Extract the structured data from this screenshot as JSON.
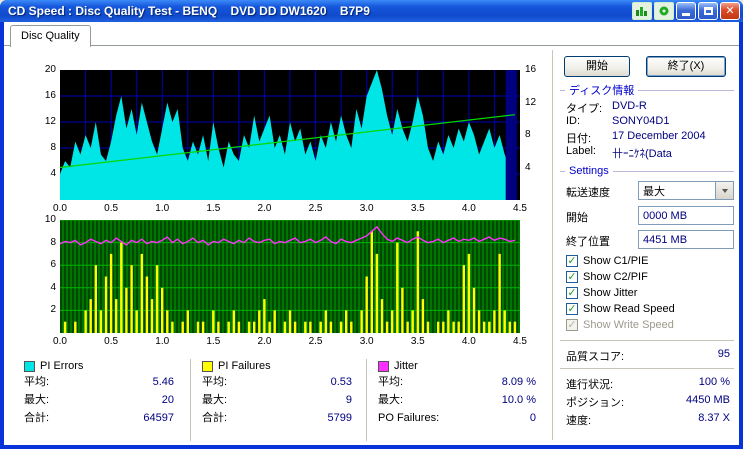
{
  "window": {
    "title": "CD Speed : Disc Quality Test - BENQ    DVD DD DW1620    B7P9"
  },
  "titlebar": {
    "icons": [
      "chart-icon",
      "disc-icon"
    ],
    "buttons": [
      "minimize",
      "maximize",
      "close"
    ]
  },
  "tab": {
    "label": "Disc Quality"
  },
  "toolbar": {
    "start_label": "開始",
    "exit_label": "終了(X)"
  },
  "disc_info": {
    "header": "ディスク情報",
    "type_label": "タイプ:",
    "type_value": "DVD-R",
    "id_label": "ID:",
    "id_value": "SONY04D1",
    "date_label": "日付:",
    "date_value": "17 December 2004",
    "label_label": "Label:",
    "label_value": "卄ｰﾆｹﾈ(Data"
  },
  "settings": {
    "header": "Settings",
    "transfer_label": "転送速度",
    "transfer_value": "最大",
    "start_label": "開始",
    "start_value": "0000 MB",
    "end_label": "終了位置",
    "end_value": "4451 MB",
    "checkboxes": [
      {
        "label": "Show C1/PIE",
        "checked": true,
        "disabled": false
      },
      {
        "label": "Show C2/PIF",
        "checked": true,
        "disabled": false
      },
      {
        "label": "Show Jitter",
        "checked": true,
        "disabled": false
      },
      {
        "label": "Show Read Speed",
        "checked": true,
        "disabled": false
      },
      {
        "label": "Show Write Speed",
        "checked": true,
        "disabled": true
      }
    ]
  },
  "status": {
    "score_label": "品質スコア:",
    "score_value": "95",
    "progress_label": "進行状況:",
    "progress_value": "100 %",
    "position_label": "ポジション:",
    "position_value": "4450 MB",
    "speed_label": "速度:",
    "speed_value": "8.37 X"
  },
  "stats": {
    "groups": [
      {
        "name": "PI Errors",
        "color": "#00E5E5",
        "rows": [
          {
            "label": "平均:",
            "value": "5.46"
          },
          {
            "label": "最大:",
            "value": "20"
          },
          {
            "label": "合計:",
            "value": "64597"
          }
        ]
      },
      {
        "name": "PI Failures",
        "color": "#FFFF00",
        "rows": [
          {
            "label": "平均:",
            "value": "0.53"
          },
          {
            "label": "最大:",
            "value": "9"
          },
          {
            "label": "合計:",
            "value": "5799"
          }
        ]
      },
      {
        "name": "Jitter",
        "color": "#FF30FF",
        "rows": [
          {
            "label": "平均:",
            "value": "8.09 %"
          },
          {
            "label": "最大:",
            "value": "10.0 %"
          },
          {
            "label": "PO Failures:",
            "value": "0"
          }
        ]
      }
    ]
  },
  "chart_data": [
    {
      "type": "area",
      "name": "pi-errors-and-read-speed",
      "x_start": 0,
      "x_step": 0.05,
      "x_end": 4.45,
      "xlim": [
        0,
        4.5
      ],
      "ylim_left": [
        0,
        20
      ],
      "yticks_left": [
        4,
        8,
        12,
        16,
        20
      ],
      "ylim_right": [
        0,
        16
      ],
      "yticks_right": [
        4,
        8,
        12,
        16
      ],
      "xticks": [
        "0.0",
        "0.5",
        "1.0",
        "1.5",
        "2.0",
        "2.5",
        "3.0",
        "3.5",
        "4.0",
        "4.5"
      ],
      "series": [
        {
          "name": "PI Errors",
          "color": "#00E5E5",
          "style": "area",
          "axis": "left",
          "values": [
            4,
            6,
            5,
            9,
            7,
            10,
            8,
            12,
            7,
            6,
            9,
            13,
            16,
            11,
            14,
            10,
            15,
            12,
            9,
            7,
            11,
            15,
            12,
            14,
            8,
            6,
            9,
            7,
            10,
            6,
            12,
            8,
            5,
            9,
            7,
            6,
            10,
            8,
            13,
            9,
            11,
            13,
            8,
            10,
            7,
            12,
            9,
            11,
            7,
            9,
            6,
            10,
            8,
            12,
            9,
            13,
            10,
            8,
            14,
            11,
            16,
            18,
            20,
            17,
            13,
            10,
            14,
            11,
            9,
            12,
            16,
            13,
            8,
            6,
            9,
            7,
            10,
            8,
            11,
            9,
            12,
            10,
            7,
            9,
            11,
            8,
            10,
            7,
            5,
            4
          ]
        },
        {
          "name": "Read Speed",
          "color": "#00D800",
          "style": "line",
          "axis": "right",
          "points": [
            [
              0,
              4.0
            ],
            [
              4.45,
              10.5
            ]
          ]
        }
      ],
      "end_marker": {
        "x0": 4.36,
        "x1": 4.47,
        "color": "#000080"
      },
      "bg": "#000000",
      "grid": "#0000B8"
    },
    {
      "type": "bar",
      "name": "pi-failures-and-jitter",
      "x_start": 0,
      "x_step": 0.05,
      "x_end": 4.45,
      "xlim": [
        0,
        4.5
      ],
      "ylim": [
        0,
        10
      ],
      "yticks": [
        2,
        4,
        6,
        8,
        10
      ],
      "xticks": [
        "0.0",
        "0.5",
        "1.0",
        "1.5",
        "2.0",
        "2.5",
        "3.0",
        "3.5",
        "4.0",
        "4.5"
      ],
      "series": [
        {
          "name": "PI Failures",
          "color": "#FFFF00",
          "style": "bar",
          "values": [
            0,
            1,
            0,
            1,
            0,
            2,
            3,
            6,
            2,
            5,
            7,
            3,
            8,
            4,
            6,
            2,
            7,
            5,
            3,
            6,
            4,
            2,
            1,
            0,
            1,
            2,
            0,
            1,
            1,
            0,
            2,
            1,
            0,
            1,
            2,
            1,
            0,
            1,
            1,
            2,
            3,
            1,
            2,
            0,
            1,
            2,
            1,
            0,
            1,
            1,
            0,
            1,
            2,
            1,
            0,
            1,
            2,
            1,
            0,
            2,
            5,
            9,
            7,
            3,
            1,
            2,
            8,
            4,
            1,
            2,
            9,
            3,
            1,
            0,
            1,
            1,
            2,
            1,
            1,
            6,
            7,
            4,
            2,
            1,
            1,
            2,
            7,
            2,
            1,
            1
          ]
        },
        {
          "name": "Jitter",
          "color": "#FF30FF",
          "style": "line",
          "values": [
            7.9,
            8.1,
            8.0,
            8.2,
            7.8,
            8.0,
            8.3,
            8.1,
            7.9,
            8.2,
            8.0,
            8.4,
            8.1,
            7.8,
            8.2,
            8.0,
            8.3,
            7.9,
            8.1,
            8.0,
            8.2,
            8.5,
            8.0,
            8.3,
            7.9,
            8.1,
            8.4,
            8.0,
            8.2,
            7.8,
            8.1,
            8.0,
            8.3,
            8.1,
            7.9,
            8.2,
            8.0,
            8.4,
            8.1,
            8.0,
            8.2,
            8.3,
            7.9,
            8.1,
            8.0,
            8.2,
            8.4,
            8.0,
            8.1,
            8.3,
            8.0,
            8.2,
            8.5,
            8.1,
            7.9,
            8.3,
            8.1,
            8.0,
            8.2,
            8.4,
            8.6,
            9.0,
            9.4,
            8.8,
            8.3,
            8.1,
            8.4,
            8.2,
            8.0,
            8.3,
            8.5,
            8.2,
            8.0,
            8.1,
            8.3,
            8.0,
            8.2,
            8.4,
            8.1,
            8.3,
            8.2,
            8.4,
            8.1,
            8.3,
            8.5,
            8.2,
            8.4,
            8.3,
            8.1,
            8.2
          ]
        }
      ],
      "bg": "#004800",
      "grid": "#00B400"
    }
  ]
}
